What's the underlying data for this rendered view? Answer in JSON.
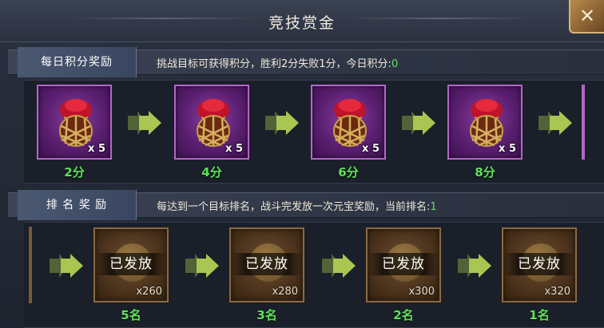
{
  "header": {
    "title": "竞技赏金",
    "close_icon": "close-icon"
  },
  "daily": {
    "title": "每日积分奖励",
    "desc_prefix": "挑战目标可获得积分，胜利2分失败1分，今日积分:",
    "desc_value": "0",
    "items": [
      {
        "qty": "x 5",
        "points": "2分",
        "icon": "treasure-jar-icon"
      },
      {
        "qty": "x 5",
        "points": "4分",
        "icon": "treasure-jar-icon"
      },
      {
        "qty": "x 5",
        "points": "6分",
        "icon": "treasure-jar-icon"
      },
      {
        "qty": "x 5",
        "points": "8分",
        "icon": "treasure-jar-icon"
      }
    ]
  },
  "rank": {
    "title": "排 名 奖 励",
    "desc_prefix": "每达到一个目标排名，战斗完发放一次元宝奖励，当前排名:",
    "desc_value": "1",
    "items": [
      {
        "status": "已发放",
        "amount": "x260",
        "rank": "5名",
        "icon": "ingot-icon"
      },
      {
        "status": "已发放",
        "amount": "x280",
        "rank": "3名",
        "icon": "ingot-icon"
      },
      {
        "status": "已发放",
        "amount": "x300",
        "rank": "2名",
        "icon": "ingot-icon"
      },
      {
        "status": "已发放",
        "amount": "x320",
        "rank": "1名",
        "icon": "ingot-icon"
      }
    ]
  },
  "colors": {
    "accent_green": "#5fe35a",
    "item_purple": "#5a1f70",
    "reward_brown": "#4a321c"
  }
}
